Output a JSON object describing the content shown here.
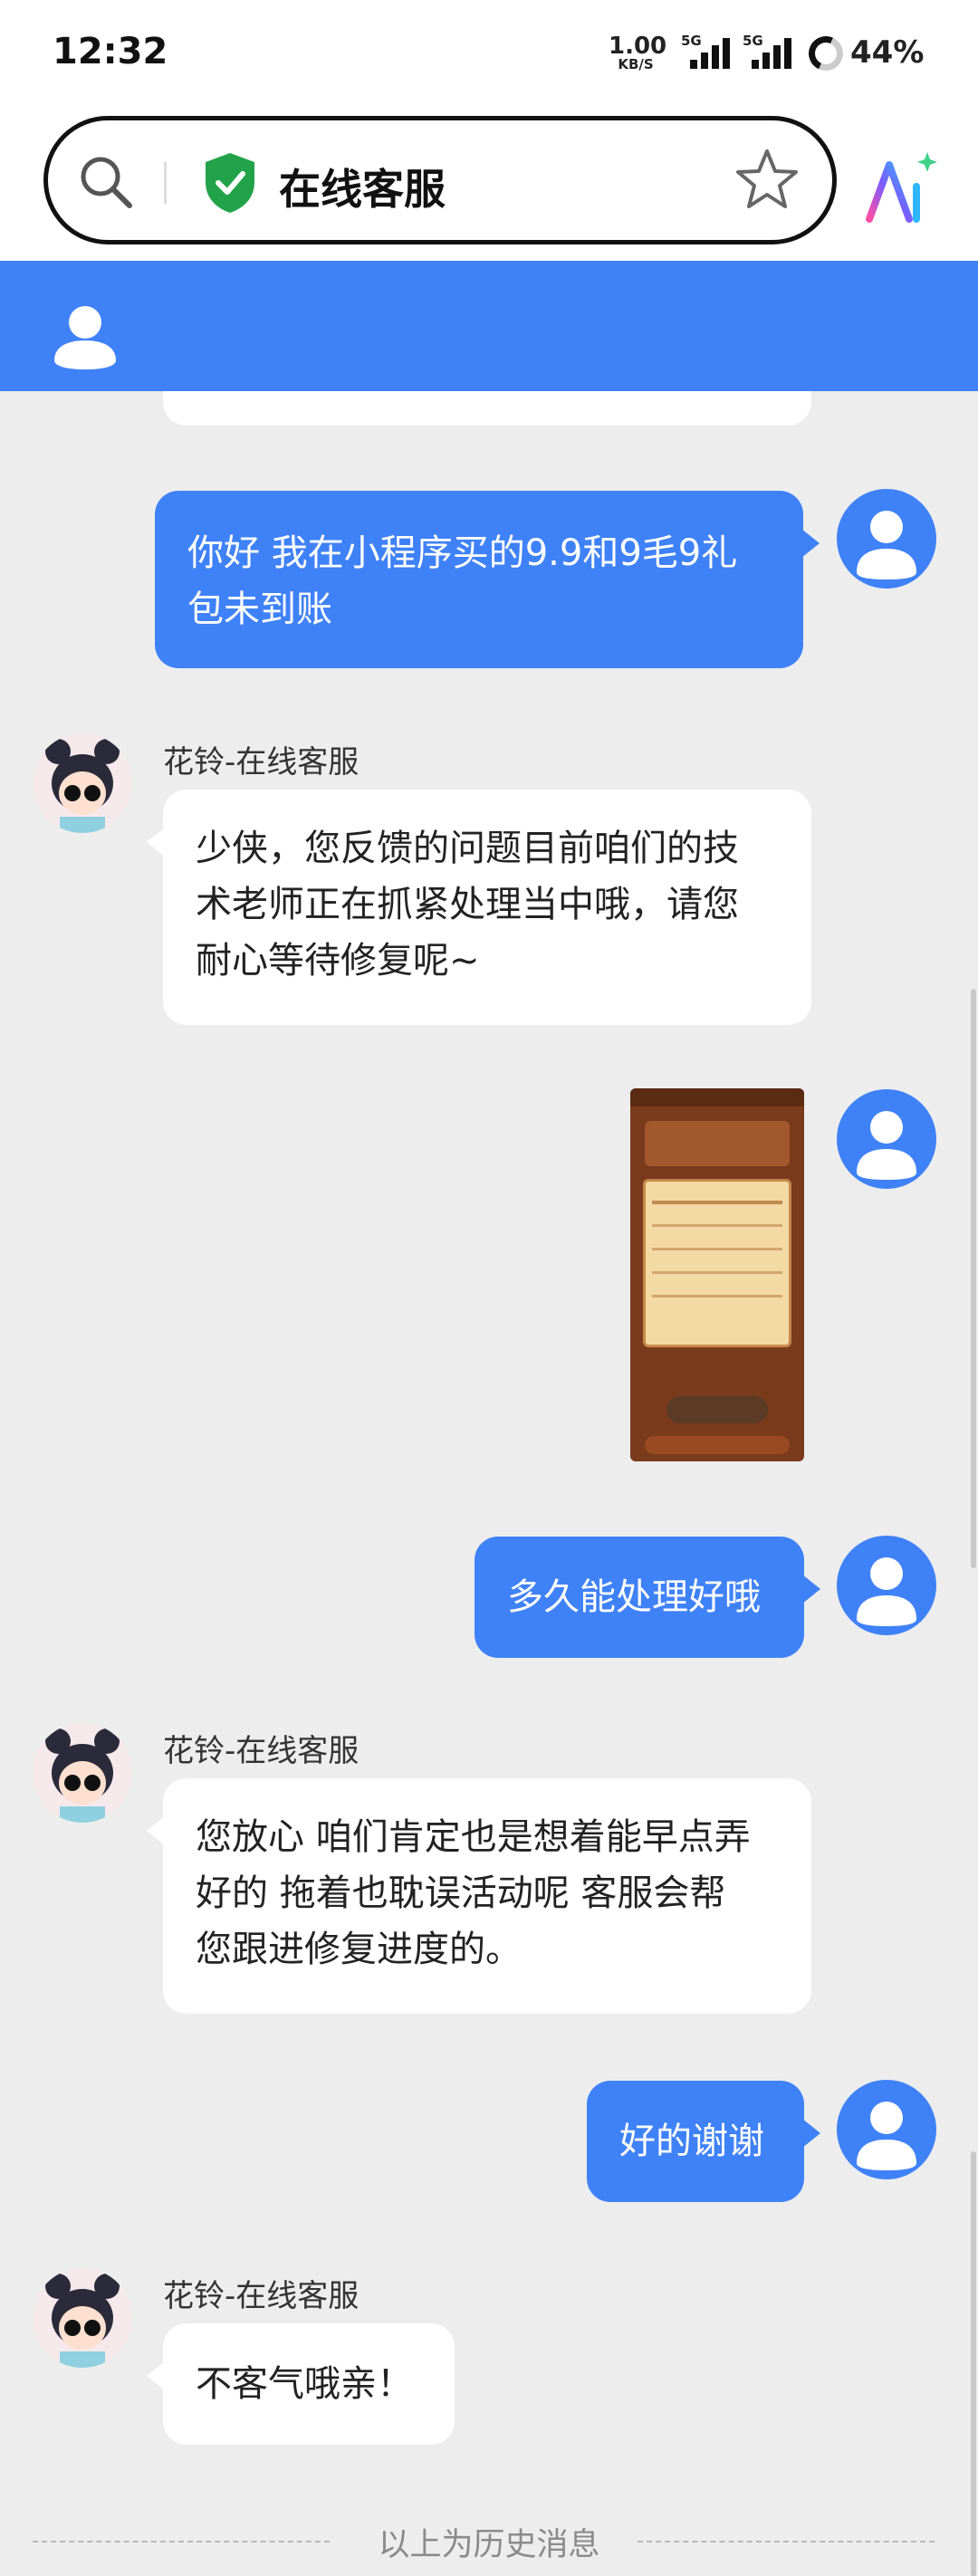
{
  "status_bar": {
    "time": "12:32",
    "net_speed_value": "1.00",
    "net_speed_unit": "KB/S",
    "sim1_label": "5G",
    "sim2_label": "5G",
    "battery": "44%"
  },
  "header": {
    "title": "在线客服",
    "icons": [
      "search-icon",
      "shield-check-icon",
      "star-icon",
      "ai-icon"
    ],
    "accent_color": "#3f82f7",
    "shield_color": "#22a34a"
  },
  "messages": [
    {
      "from": "user",
      "type": "text",
      "text_lines": [
        "你好 我在小程序买的9.9和9毛9礼",
        "包未到账"
      ]
    },
    {
      "from": "agent",
      "name": "花铃-在线客服",
      "type": "text",
      "text_lines": [
        "少侠，您反馈的问题目前咱们的技",
        "术老师正在抓紧处理当中哦，请您",
        "耐心等待修复呢~"
      ]
    },
    {
      "from": "user",
      "type": "image"
    },
    {
      "from": "user",
      "type": "text",
      "text_lines": [
        "多久能处理好哦"
      ]
    },
    {
      "from": "agent",
      "name": "花铃-在线客服",
      "type": "text",
      "text_lines": [
        "您放心 咱们肯定也是想着能早点弄",
        "好的 拖着也耽误活动呢 客服会帮",
        "您跟进修复进度的。"
      ]
    },
    {
      "from": "user",
      "type": "text",
      "text_lines": [
        "好的谢谢"
      ]
    },
    {
      "from": "agent",
      "name": "花铃-在线客服",
      "type": "text",
      "text_lines": [
        "不客气哦亲！"
      ]
    }
  ],
  "history_divider": "以上为历史消息"
}
